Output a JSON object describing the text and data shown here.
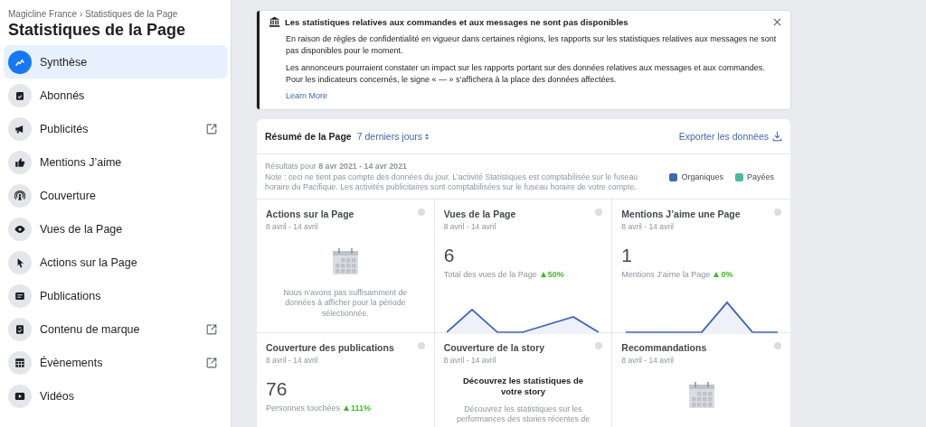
{
  "sidebar": {
    "breadcrumb": "Magicline France › Statistiques de la Page",
    "title": "Statistiques de la Page",
    "items": [
      {
        "label": "Synthèse",
        "selected": true,
        "external": false
      },
      {
        "label": "Abonnés",
        "selected": false,
        "external": false
      },
      {
        "label": "Publicités",
        "selected": false,
        "external": true
      },
      {
        "label": "Mentions J’aime",
        "selected": false,
        "external": false
      },
      {
        "label": "Couverture",
        "selected": false,
        "external": false
      },
      {
        "label": "Vues de la Page",
        "selected": false,
        "external": false
      },
      {
        "label": "Actions sur la Page",
        "selected": false,
        "external": false
      },
      {
        "label": "Publications",
        "selected": false,
        "external": false
      },
      {
        "label": "Contenu de marque",
        "selected": false,
        "external": true
      },
      {
        "label": "Évènements",
        "selected": false,
        "external": true
      },
      {
        "label": "Vidéos",
        "selected": false,
        "external": false
      }
    ]
  },
  "notice": {
    "title": "Les statistiques relatives aux commandes et aux messages ne sont pas disponibles",
    "paragraphs": [
      "En raison de règles de confidentialité en vigueur dans certaines régions, les rapports sur les statistiques relatives aux messages ne sont pas disponibles pour le moment.",
      "Les annonceurs pourraient constater un impact sur les rapports portant sur des données relatives aux messages et aux commandes. Pour les indicateurs concernés, le signe « — » s’affichera à la place des données affectées."
    ],
    "link": "Learn More"
  },
  "summary": {
    "title": "Résumé de la Page",
    "period": "7 derniers jours",
    "export": "Exporter les données",
    "results": "Résultats pour **8 avr 2021 - 14 avr 2021**",
    "note": "Note : ceci ne tient pas compte des données du jour. L’activité Statistiques est comptabilisée sur le fuseau horaire du Pacifique. Les activités publicitaires sont comptabilisées sur le fuseau horaire de votre compte.",
    "legend": [
      {
        "label": "Organiques",
        "color": "#4267b2"
      },
      {
        "label": "Payées",
        "color": "#4cb8a0"
      }
    ],
    "cards": [
      {
        "kind": "empty",
        "title": "Actions sur la Page",
        "dates": "8 avril - 14 avril",
        "message": "Nous n’avons pas suffisamment de données à afficher pour la période sélectionnée."
      },
      {
        "kind": "metric",
        "title": "Vues de la Page",
        "dates": "8 avril - 14 avril",
        "value": "6",
        "label": "Total des vues de la Page",
        "change": "50%"
      },
      {
        "kind": "metric",
        "title": "Mentions J’aime une Page",
        "dates": "8 avril - 14 avril",
        "value": "1",
        "label": "Mentions J’aime la Page",
        "change": "0%"
      },
      {
        "kind": "metric",
        "title": "Couverture des publications",
        "dates": "8 avril - 14 avril",
        "value": "76",
        "label": "Personnes touchées",
        "change": "111%"
      },
      {
        "kind": "story",
        "title": "Couverture de la story",
        "dates": "8 avril - 14 avril",
        "heading": "Découvrez les statistiques de votre story",
        "message": "Découvrez les statistiques sur les performances des stories récentes de"
      },
      {
        "kind": "empty",
        "title": "Recommandations",
        "dates": "8 avril - 14 avril"
      }
    ]
  }
}
